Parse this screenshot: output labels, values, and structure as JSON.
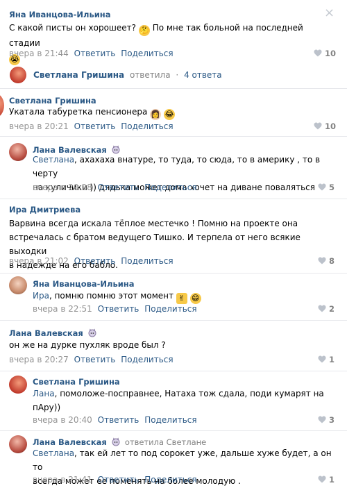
{
  "close_glyph": "×",
  "c1": {
    "author": "Яна Иванцова-Ильина",
    "text1": "С какой писты он хорошеет?",
    "text2": "По мне так больной на последней стадии",
    "time": "вчера в 21:44",
    "reply": "Ответить",
    "share": "Поделиться",
    "likes": "10"
  },
  "thread": {
    "author": "Светлана Гришина",
    "replied": "ответила",
    "dot": "·",
    "answers": "4 ответа"
  },
  "c2": {
    "author": "Светлана Гришина",
    "text": "Укатала табуретка пенсионера",
    "time": "вчера в 20:21",
    "reply": "Ответить",
    "share": "Поделиться",
    "likes": "10"
  },
  "c3": {
    "author": "Лана Валевская",
    "addressee": "Светлана",
    "text1": ", ахахаха внатуре, то туда, то сюда, то в америку , то в черту",
    "text2": "на куличики )) дядька может дома хочет на диване поваляться",
    "time": "вчера в 20:28",
    "reply": "Ответить",
    "share": "Поделиться",
    "likes": "5"
  },
  "c4": {
    "author": "Ира Дмитриева",
    "text1": "Варвина всегда искала тёплое местечко ! Помню на проекте она",
    "text2": "встречалась с братом ведущего Тишко. И терпела от него всякие выходки",
    "text3": "в надежде на его бабло.",
    "time": "вчера в 21:02",
    "reply": "Ответить",
    "share": "Поделиться",
    "likes": "8"
  },
  "c5": {
    "author": "Яна Иванцова-Ильина",
    "addressee": "Ира",
    "text": ", помню помню этот момент",
    "time": "вчера в 22:51",
    "reply": "Ответить",
    "share": "Поделиться",
    "likes": "2"
  },
  "c6": {
    "author": "Лана Валевская",
    "text": "он же на дурке пухляк вроде был ?",
    "time": "вчера в 20:27",
    "reply": "Ответить",
    "share": "Поделиться",
    "likes": "1"
  },
  "c7": {
    "author": "Светлана Гришина",
    "addressee": "Лана",
    "text1": ", помоложе-посправнее, Натаха тож сдала, поди кумарят на",
    "text2": "пАру))",
    "time": "вчера в 20:40",
    "reply": "Ответить",
    "share": "Поделиться",
    "likes": "3"
  },
  "c8": {
    "author": "Лана Валевская",
    "replied_to": "ответила Светлане",
    "addressee": "Светлана",
    "text1": ", так ей лет то под сорокет уже, дальше хуже будет, а он то",
    "text2": "всегда может ее поменять на более молодую .",
    "time": "вчера в 21:41",
    "reply": "Ответить",
    "share": "Поделиться",
    "likes": "1"
  },
  "colors": {
    "link": "#2a5885",
    "meta": "#939393",
    "separator": "#e7e8ec"
  }
}
